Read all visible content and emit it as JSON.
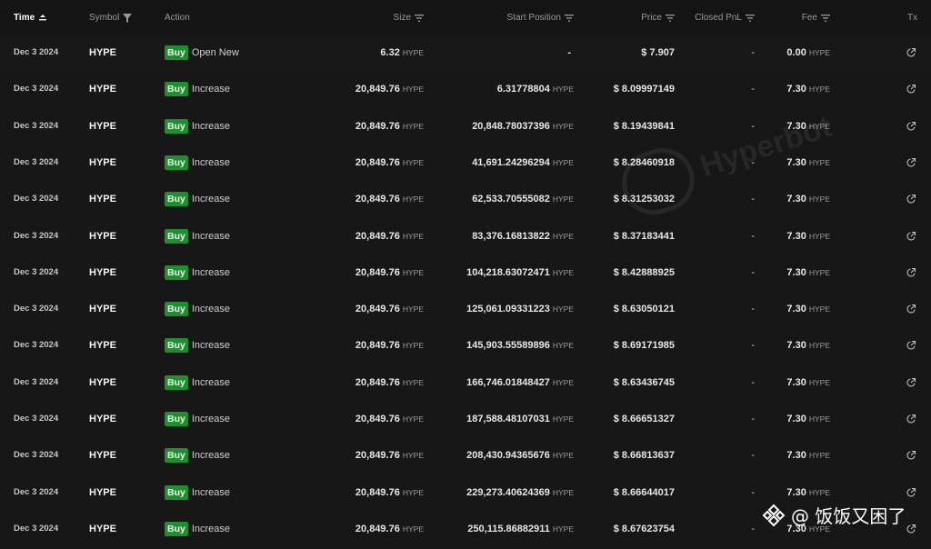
{
  "header": {
    "time": "Time",
    "symbol": "Symbol",
    "action": "Action",
    "size": "Size",
    "start_position": "Start Position",
    "price": "Price",
    "closed_pnl": "Closed PnL",
    "fee": "Fee",
    "tx": "Tx"
  },
  "rows": [
    {
      "time": "Dec 3 2024",
      "symbol": "HYPE",
      "side": "Buy",
      "action": "Open New",
      "size": "6.32",
      "size_unit": "HYPE",
      "start": "-",
      "start_unit": "",
      "price": "$ 7.907",
      "pnl": "-",
      "fee": "0.00",
      "fee_unit": "HYPE"
    },
    {
      "time": "Dec 3 2024",
      "symbol": "HYPE",
      "side": "Buy",
      "action": "Increase",
      "size": "20,849.76",
      "size_unit": "HYPE",
      "start": "6.31778804",
      "start_unit": "HYPE",
      "price": "$ 8.09997149",
      "pnl": "-",
      "fee": "7.30",
      "fee_unit": "HYPE"
    },
    {
      "time": "Dec 3 2024",
      "symbol": "HYPE",
      "side": "Buy",
      "action": "Increase",
      "size": "20,849.76",
      "size_unit": "HYPE",
      "start": "20,848.78037396",
      "start_unit": "HYPE",
      "price": "$ 8.19439841",
      "pnl": "-",
      "fee": "7.30",
      "fee_unit": "HYPE"
    },
    {
      "time": "Dec 3 2024",
      "symbol": "HYPE",
      "side": "Buy",
      "action": "Increase",
      "size": "20,849.76",
      "size_unit": "HYPE",
      "start": "41,691.24296294",
      "start_unit": "HYPE",
      "price": "$ 8.28460918",
      "pnl": "-",
      "fee": "7.30",
      "fee_unit": "HYPE"
    },
    {
      "time": "Dec 3 2024",
      "symbol": "HYPE",
      "side": "Buy",
      "action": "Increase",
      "size": "20,849.76",
      "size_unit": "HYPE",
      "start": "62,533.70555082",
      "start_unit": "HYPE",
      "price": "$ 8.31253032",
      "pnl": "-",
      "fee": "7.30",
      "fee_unit": "HYPE"
    },
    {
      "time": "Dec 3 2024",
      "symbol": "HYPE",
      "side": "Buy",
      "action": "Increase",
      "size": "20,849.76",
      "size_unit": "HYPE",
      "start": "83,376.16813822",
      "start_unit": "HYPE",
      "price": "$ 8.37183441",
      "pnl": "-",
      "fee": "7.30",
      "fee_unit": "HYPE"
    },
    {
      "time": "Dec 3 2024",
      "symbol": "HYPE",
      "side": "Buy",
      "action": "Increase",
      "size": "20,849.76",
      "size_unit": "HYPE",
      "start": "104,218.63072471",
      "start_unit": "HYPE",
      "price": "$ 8.42888925",
      "pnl": "-",
      "fee": "7.30",
      "fee_unit": "HYPE"
    },
    {
      "time": "Dec 3 2024",
      "symbol": "HYPE",
      "side": "Buy",
      "action": "Increase",
      "size": "20,849.76",
      "size_unit": "HYPE",
      "start": "125,061.09331223",
      "start_unit": "HYPE",
      "price": "$ 8.63050121",
      "pnl": "-",
      "fee": "7.30",
      "fee_unit": "HYPE"
    },
    {
      "time": "Dec 3 2024",
      "symbol": "HYPE",
      "side": "Buy",
      "action": "Increase",
      "size": "20,849.76",
      "size_unit": "HYPE",
      "start": "145,903.55589896",
      "start_unit": "HYPE",
      "price": "$ 8.69171985",
      "pnl": "-",
      "fee": "7.30",
      "fee_unit": "HYPE"
    },
    {
      "time": "Dec 3 2024",
      "symbol": "HYPE",
      "side": "Buy",
      "action": "Increase",
      "size": "20,849.76",
      "size_unit": "HYPE",
      "start": "166,746.01848427",
      "start_unit": "HYPE",
      "price": "$ 8.63436745",
      "pnl": "-",
      "fee": "7.30",
      "fee_unit": "HYPE"
    },
    {
      "time": "Dec 3 2024",
      "symbol": "HYPE",
      "side": "Buy",
      "action": "Increase",
      "size": "20,849.76",
      "size_unit": "HYPE",
      "start": "187,588.48107031",
      "start_unit": "HYPE",
      "price": "$ 8.66651327",
      "pnl": "-",
      "fee": "7.30",
      "fee_unit": "HYPE"
    },
    {
      "time": "Dec 3 2024",
      "symbol": "HYPE",
      "side": "Buy",
      "action": "Increase",
      "size": "20,849.76",
      "size_unit": "HYPE",
      "start": "208,430.94365676",
      "start_unit": "HYPE",
      "price": "$ 8.66813637",
      "pnl": "-",
      "fee": "7.30",
      "fee_unit": "HYPE"
    },
    {
      "time": "Dec 3 2024",
      "symbol": "HYPE",
      "side": "Buy",
      "action": "Increase",
      "size": "20,849.76",
      "size_unit": "HYPE",
      "start": "229,273.40624369",
      "start_unit": "HYPE",
      "price": "$ 8.66644017",
      "pnl": "-",
      "fee": "7.30",
      "fee_unit": "HYPE"
    },
    {
      "time": "Dec 3 2024",
      "symbol": "HYPE",
      "side": "Buy",
      "action": "Increase",
      "size": "20,849.76",
      "size_unit": "HYPE",
      "start": "250,115.86882911",
      "start_unit": "HYPE",
      "price": "$ 8.67623754",
      "pnl": "-",
      "fee": "7.30",
      "fee_unit": "HYPE"
    }
  ],
  "watermark": {
    "text": "Hyperbot"
  },
  "author": {
    "handle": "@ 饭饭又困了"
  },
  "icons": {
    "tx": "external-link-icon",
    "sort": "sort-icon",
    "filter": "filter-icon",
    "author": "binance-logo-icon"
  },
  "colors": {
    "buy_badge": "#1e8f2f",
    "background": "#171717"
  }
}
